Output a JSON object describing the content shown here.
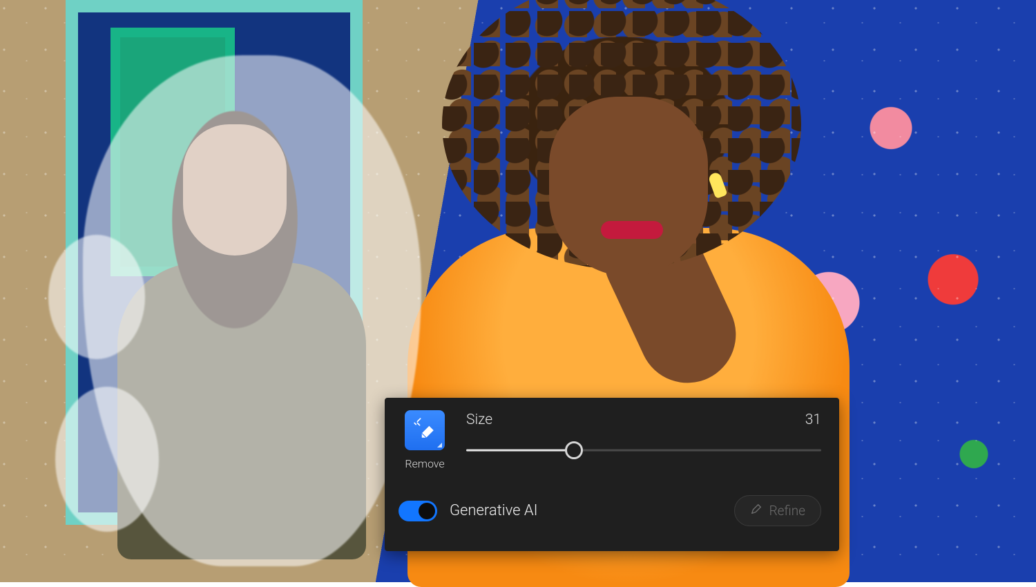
{
  "tool": {
    "icon": "eraser-sparkle-icon",
    "label": "Remove",
    "accent_color": "#2a7bff"
  },
  "slider": {
    "label": "Size",
    "value": 31,
    "min": 1,
    "max": 100
  },
  "toggle": {
    "label": "Generative AI",
    "state": true,
    "on_color": "#1276ff"
  },
  "refine": {
    "label": "Refine",
    "icon": "pencil-icon",
    "enabled": false
  },
  "selection": {
    "overlay_opacity": 0.55,
    "description": "brush-selection-mask"
  }
}
